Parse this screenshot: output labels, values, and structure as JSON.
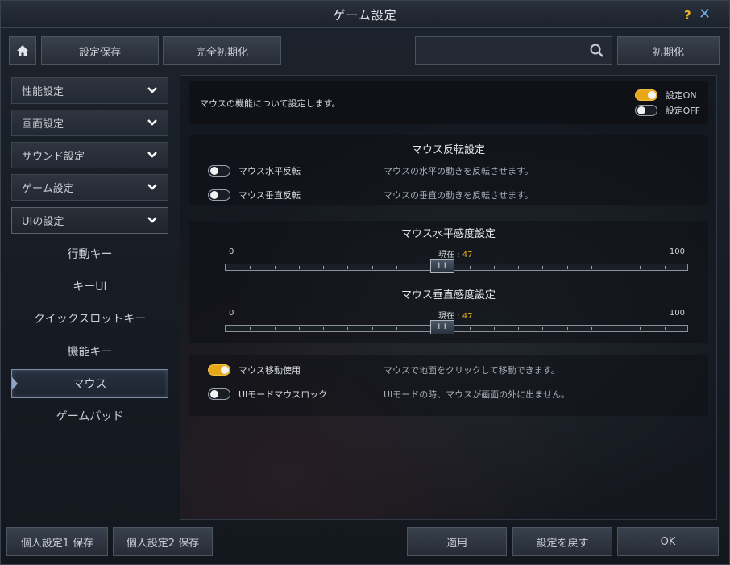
{
  "window": {
    "title": "ゲーム設定",
    "help_label": "?",
    "close_label": "✕"
  },
  "toolbar": {
    "home_icon": "home-icon",
    "save_label": "設定保存",
    "full_reset_label": "完全初期化",
    "search_value": "",
    "search_placeholder": "",
    "search_icon": "search-icon",
    "reset_label": "初期化"
  },
  "sidebar": {
    "categories": [
      {
        "label": "性能設定"
      },
      {
        "label": "画面設定"
      },
      {
        "label": "サウンド設定"
      },
      {
        "label": "ゲーム設定"
      },
      {
        "label": "UIの設定"
      }
    ],
    "sub_items": [
      {
        "label": "行動キー"
      },
      {
        "label": "キーUI"
      },
      {
        "label": "クイックスロットキー"
      },
      {
        "label": "機能キー"
      },
      {
        "label": "マウス"
      },
      {
        "label": "ゲームパッド"
      }
    ],
    "active_item": "マウス"
  },
  "content": {
    "description": "マウスの機能について設定します。",
    "legend": {
      "on_label": "設定ON",
      "off_label": "設定OFF"
    },
    "invert_section": {
      "title": "マウス反転設定",
      "options": [
        {
          "label": "マウス水平反転",
          "desc": "マウスの水平の動きを反転させます。",
          "on": false
        },
        {
          "label": "マウス垂直反転",
          "desc": "マウスの垂直の動きを反転させます。",
          "on": false
        }
      ]
    },
    "h_sensitivity": {
      "title": "マウス水平感度設定",
      "min": "0",
      "max": "100",
      "current_label": "現在 : ",
      "current": "47",
      "value": 47,
      "thumb_label": "III"
    },
    "v_sensitivity": {
      "title": "マウス垂直感度設定",
      "min": "0",
      "max": "100",
      "current_label": "現在 : ",
      "current": "47",
      "value": 47,
      "thumb_label": "III"
    },
    "move_section": {
      "options": [
        {
          "label": "マウス移動使用",
          "desc": "マウスで地面をクリックして移動できます。",
          "on": true
        },
        {
          "label": "UIモードマウスロック",
          "desc": "UIモードの時、マウスが画面の外に出ません。",
          "on": false
        }
      ]
    }
  },
  "bottom": {
    "personal1_label": "個人設定1 保存",
    "personal2_label": "個人設定2 保存",
    "apply_label": "適用",
    "revert_label": "設定を戻す",
    "ok_label": "OK"
  },
  "colors": {
    "toggle_on": "#e6a817",
    "accent_value": "#e6b020",
    "help": "#e9b320",
    "close": "#6fa9e8"
  }
}
